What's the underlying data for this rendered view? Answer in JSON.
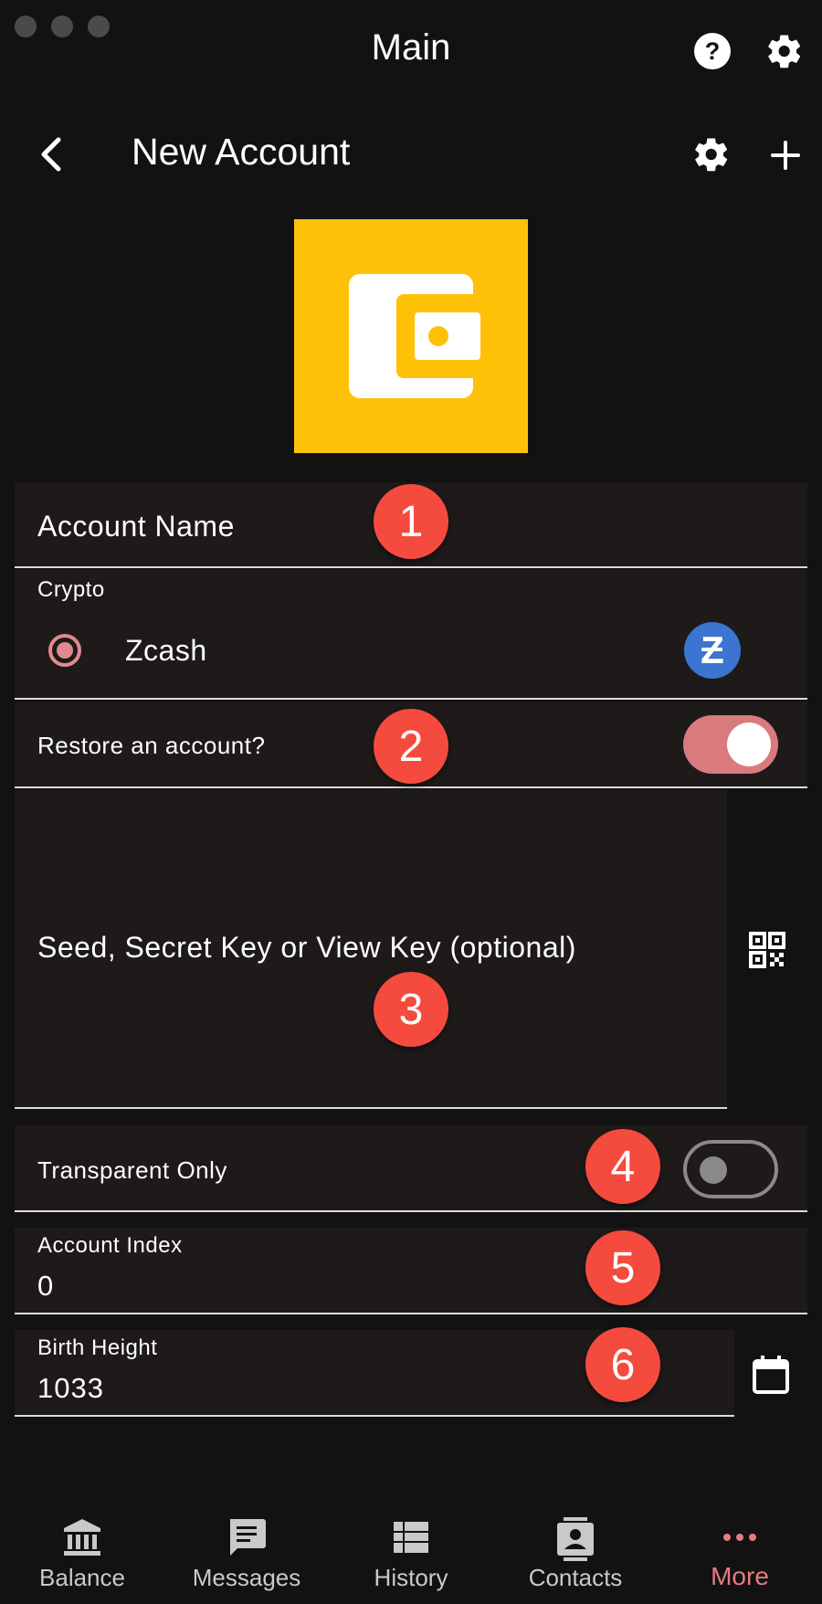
{
  "window": {
    "title": "Main"
  },
  "appbar": {
    "title": "New Account"
  },
  "form": {
    "account_name_label": "Account Name",
    "crypto_label": "Crypto",
    "crypto_option": "Zcash",
    "restore_label": "Restore an account?",
    "restore_enabled": true,
    "seed_placeholder": "Seed, Secret Key or View Key (optional)",
    "transparent_label": "Transparent Only",
    "transparent_enabled": false,
    "account_index_label": "Account Index",
    "account_index_value": "0",
    "birth_height_label": "Birth Height",
    "birth_height_value": "1033"
  },
  "badges": [
    "1",
    "2",
    "3",
    "4",
    "5",
    "6"
  ],
  "nav": {
    "items": [
      {
        "label": "Balance",
        "icon": "bank-icon"
      },
      {
        "label": "Messages",
        "icon": "message-icon"
      },
      {
        "label": "History",
        "icon": "list-icon"
      },
      {
        "label": "Contacts",
        "icon": "contact-icon"
      },
      {
        "label": "More",
        "icon": "more-icon"
      }
    ],
    "active": "More"
  },
  "colors": {
    "background": "#121212",
    "panel": "#1e1a1a",
    "accent": "#d97a7f",
    "logo": "#ffc107",
    "badge": "#f44b3e",
    "zcash": "#3b74d1"
  }
}
